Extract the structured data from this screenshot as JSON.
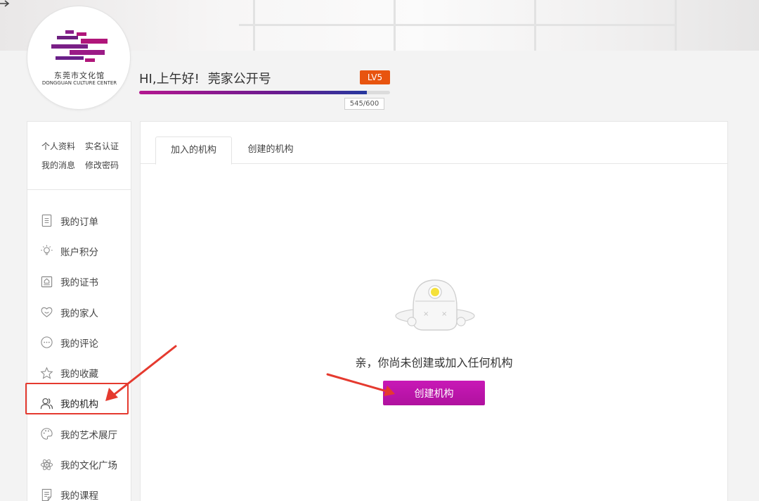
{
  "logo": {
    "name_cn": "东莞市文化馆",
    "name_en": "DONGGUAN CULTURE CENTER"
  },
  "user": {
    "greeting": "HI,上午好!",
    "username": "莞家公开号",
    "level": "LV5",
    "xp_text": "545/600",
    "xp_progress": 0.908
  },
  "sidebar": {
    "quick_links": [
      "个人资料",
      "实名认证",
      "我的消息",
      "修改密码"
    ],
    "items": [
      {
        "label": "我的订单",
        "icon": "order-icon"
      },
      {
        "label": "账户积分",
        "icon": "bulb-icon"
      },
      {
        "label": "我的证书",
        "icon": "certificate-icon"
      },
      {
        "label": "我的家人",
        "icon": "heart-smile-icon"
      },
      {
        "label": "我的评论",
        "icon": "comment-icon"
      },
      {
        "label": "我的收藏",
        "icon": "star-icon"
      },
      {
        "label": "我的机构",
        "icon": "users-icon"
      },
      {
        "label": "我的艺术展厅",
        "icon": "palette-icon"
      },
      {
        "label": "我的文化广场",
        "icon": "atom-icon"
      },
      {
        "label": "我的课程",
        "icon": "course-icon"
      }
    ],
    "active_item": "我的机构"
  },
  "main": {
    "tabs": [
      {
        "label": "加入的机构",
        "active": true
      },
      {
        "label": "创建的机构",
        "active": false
      }
    ],
    "empty_message": "亲，你尚未创建或加入任何机构",
    "create_button": "创建机构"
  },
  "colors": {
    "accent_magenta": "#c114ae",
    "level_badge": "#e8540f",
    "annotation_red": "#e53a2f"
  }
}
